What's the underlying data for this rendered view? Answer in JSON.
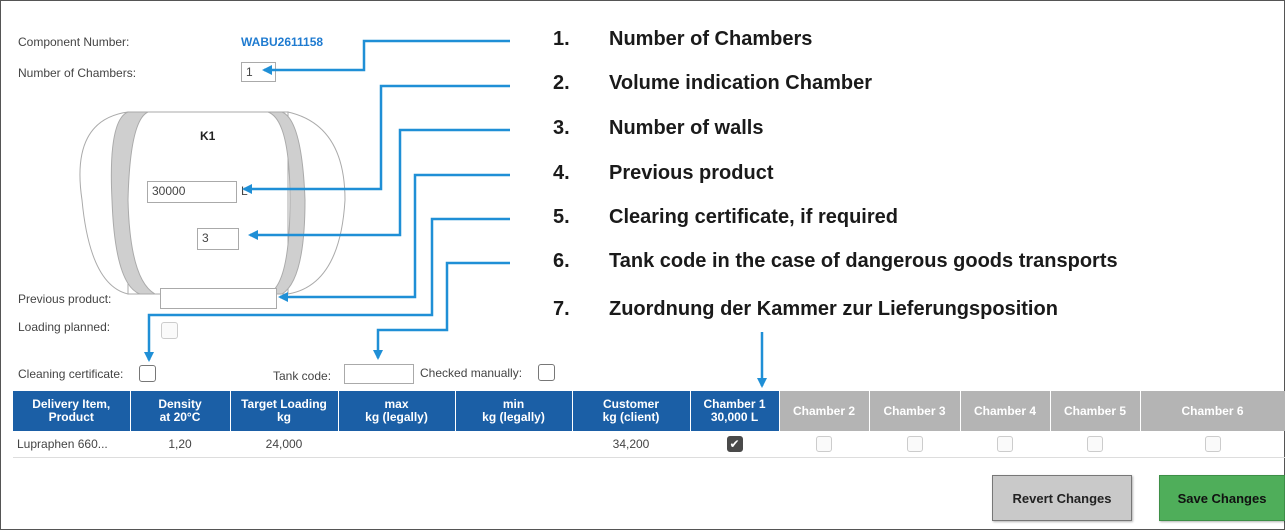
{
  "form": {
    "component_number_label": "Component Number:",
    "component_number_value": "WABU2611158",
    "chambers_label": "Number of Chambers:",
    "chambers_value": "1",
    "tank_label": "K1",
    "volume_value": "30000",
    "volume_unit": "L",
    "walls_value": "3",
    "previous_product_label": "Previous product:",
    "previous_product_value": "",
    "loading_planned_label": "Loading planned:",
    "cleaning_certificate_label": "Cleaning certificate:",
    "tank_code_label": "Tank code:",
    "tank_code_value": "",
    "checked_manually_label": "Checked manually:"
  },
  "annotations": [
    {
      "num": "1.",
      "text": "Number of Chambers"
    },
    {
      "num": "2.",
      "text": "Volume indication Chamber"
    },
    {
      "num": "3.",
      "text": "Number of walls"
    },
    {
      "num": "4.",
      "text": "Previous product"
    },
    {
      "num": "5.",
      "text": "Clearing certificate, if required"
    },
    {
      "num": "6.",
      "text": "Tank code in the case of dangerous goods transports"
    },
    {
      "num": "7.",
      "text": "Zuordnung der Kammer zur Lieferungsposition"
    }
  ],
  "table": {
    "headers": [
      {
        "l1": "Delivery Item,",
        "l2": "Product"
      },
      {
        "l1": "Density",
        "l2": "at 20°C"
      },
      {
        "l1": "Target Loading",
        "l2": "kg"
      },
      {
        "l1": "max",
        "l2": "kg (legally)"
      },
      {
        "l1": "min",
        "l2": "kg (legally)"
      },
      {
        "l1": "Customer",
        "l2": "kg (client)"
      },
      {
        "l1": "Chamber 1",
        "l2": "30,000 L"
      },
      {
        "l1": "Chamber 2",
        "l2": ""
      },
      {
        "l1": "Chamber 3",
        "l2": ""
      },
      {
        "l1": "Chamber 4",
        "l2": ""
      },
      {
        "l1": "Chamber 5",
        "l2": ""
      },
      {
        "l1": "Chamber 6",
        "l2": ""
      }
    ],
    "row": {
      "product": "Lupraphen 660...",
      "density": "1,20",
      "target": "24,000",
      "max": "",
      "min": "",
      "customer": "34,200",
      "chamber1_checked": true
    }
  },
  "buttons": {
    "revert": "Revert Changes",
    "save": "Save Changes"
  },
  "colors": {
    "accent_blue": "#1b5fa6",
    "arrow_blue": "#1f8fd6",
    "link_blue": "#1f7bd0",
    "save_green": "#4fae5a",
    "disabled_grey": "#b4b4b4"
  }
}
